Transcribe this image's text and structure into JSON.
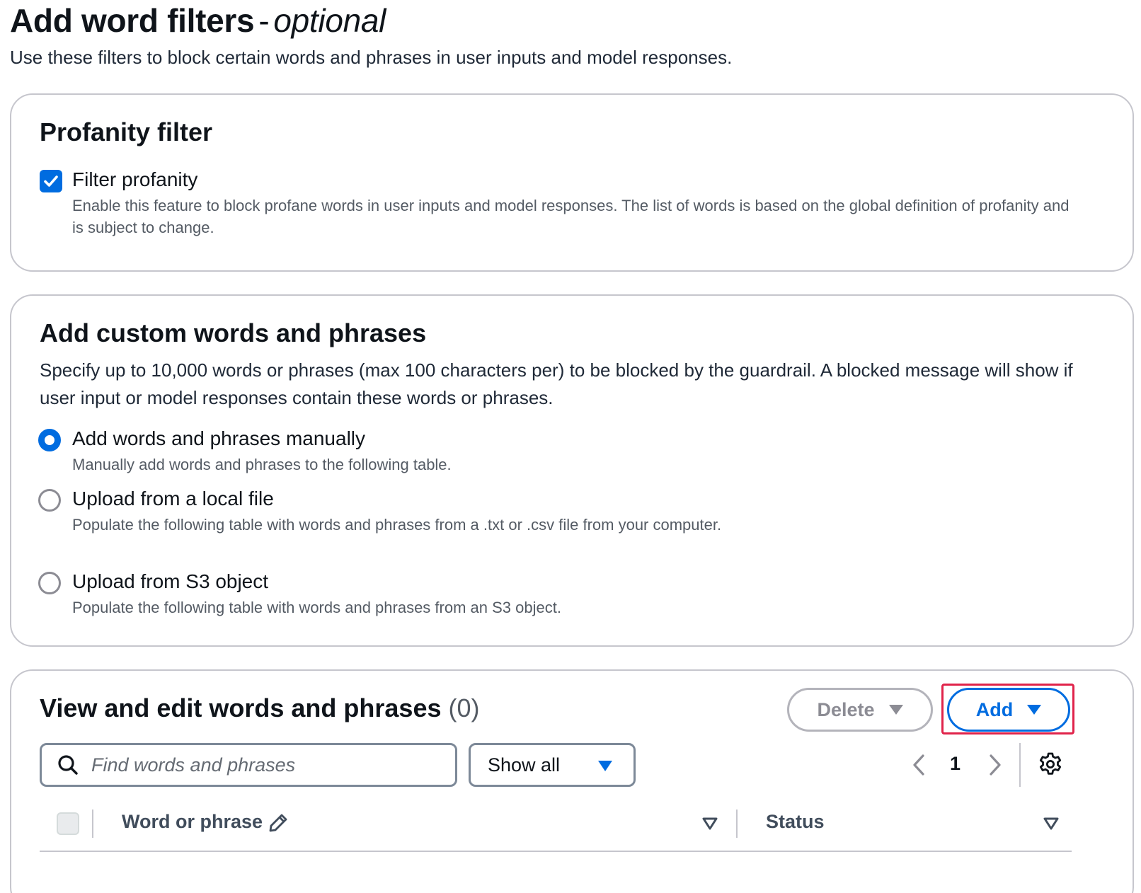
{
  "header": {
    "title": "Add word filters",
    "separator": "-",
    "title_optional": "optional",
    "subtitle": "Use these filters to block certain words and phrases in user inputs and model responses."
  },
  "profanity": {
    "heading": "Profanity filter",
    "checkbox_label": "Filter profanity",
    "checkbox_checked": true,
    "checkbox_description": "Enable this feature to block profane words in user inputs and model responses. The list of words is based on the global definition of profanity and is subject to change."
  },
  "custom": {
    "heading": "Add custom words and phrases",
    "description": "Specify up to 10,000 words or phrases (max 100 characters per) to be blocked by the guardrail. A blocked message will show if user input or model responses contain these words or phrases.",
    "options": [
      {
        "label": "Add words and phrases manually",
        "description": "Manually add words and phrases to the following table.",
        "selected": true
      },
      {
        "label": "Upload from a local file",
        "description": "Populate the following table with words and phrases from a .txt or .csv file from your computer.",
        "selected": false
      },
      {
        "label": "Upload from S3 object",
        "description": "Populate the following table with words and phrases from an S3 object.",
        "selected": false
      }
    ]
  },
  "table_panel": {
    "heading": "View and edit words and phrases",
    "count": "(0)",
    "delete_label": "Delete",
    "add_label": "Add",
    "search_placeholder": "Find words and phrases",
    "filter_value": "Show all",
    "page_number": "1",
    "columns": [
      "Word or phrase",
      "Status"
    ]
  },
  "colors": {
    "accent": "#006ce0",
    "highlight": "#e0234a",
    "border": "#c6c6cd",
    "muted_text": "#545b64"
  },
  "icons": [
    "checkmark-icon",
    "search-icon",
    "chevron-left-icon",
    "chevron-right-icon",
    "settings-gear-icon",
    "pencil-icon",
    "sort-down-icon",
    "caret-down-icon"
  ]
}
